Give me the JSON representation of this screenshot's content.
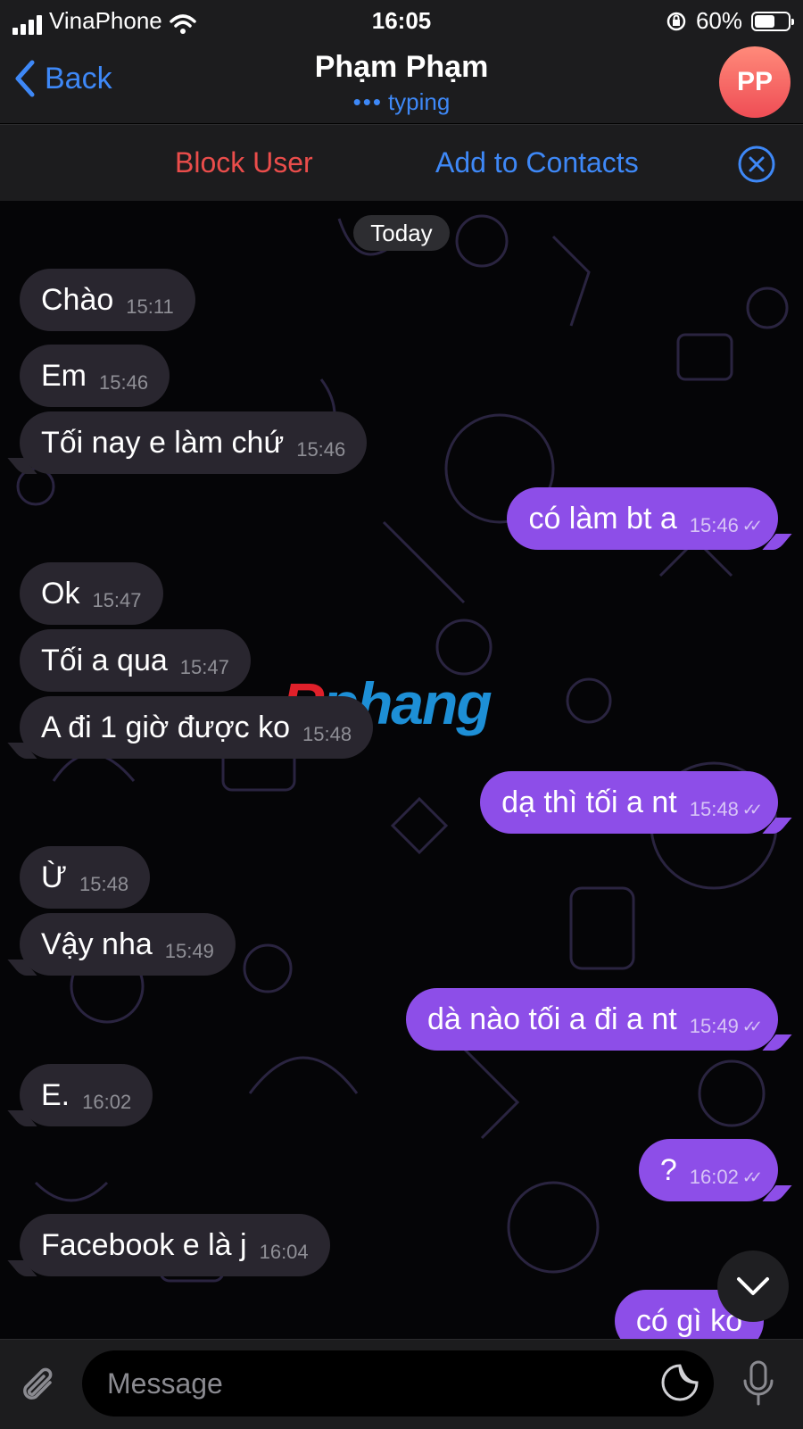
{
  "status_bar": {
    "carrier": "VinaPhone",
    "time": "16:05",
    "battery": "60%",
    "battery_level": 0.6
  },
  "header": {
    "back_label": "Back",
    "title": "Phạm Phạm",
    "status": "typing",
    "avatar_initials": "PP"
  },
  "actions": {
    "block_label": "Block User",
    "add_contacts_label": "Add to Contacts"
  },
  "chat": {
    "date_separator": "Today",
    "messages": [
      {
        "dir": "in",
        "text": "Chào",
        "time": "15:11"
      },
      {
        "dir": "in",
        "text": "Em",
        "time": "15:46"
      },
      {
        "dir": "in",
        "text": "Tối nay e làm chứ",
        "time": "15:46"
      },
      {
        "dir": "out",
        "text": "có làm bt a",
        "time": "15:46",
        "read": true
      },
      {
        "dir": "in",
        "text": "Ok",
        "time": "15:47"
      },
      {
        "dir": "in",
        "text": "Tối a qua",
        "time": "15:47"
      },
      {
        "dir": "in",
        "text": "A đi 1 giờ được ko",
        "time": "15:48"
      },
      {
        "dir": "out",
        "text": "dạ thì tối a nt",
        "time": "15:48",
        "read": true
      },
      {
        "dir": "in",
        "text": "Ừ",
        "time": "15:48"
      },
      {
        "dir": "in",
        "text": "Vậy nha",
        "time": "15:49"
      },
      {
        "dir": "out",
        "text": "dà nào tối a đi a nt",
        "time": "15:49",
        "read": true
      },
      {
        "dir": "in",
        "text": "E.",
        "time": "16:02"
      },
      {
        "dir": "out",
        "text": "?",
        "time": "16:02",
        "read": true
      },
      {
        "dir": "in",
        "text": "Facebook e là j",
        "time": "16:04"
      },
      {
        "dir": "out",
        "text": "có gì ko",
        "time": "",
        "read": false
      }
    ]
  },
  "watermark": {
    "part1": "R",
    "part2": "phang"
  },
  "composer": {
    "placeholder": "Message"
  },
  "colors": {
    "accent": "#3e88f7",
    "danger": "#eb4d4b",
    "outgoing_bubble": "#8d4ee8",
    "incoming_bubble": "#29262f",
    "avatar": "#ef5a5a"
  },
  "icons": {
    "back": "chevron-left-icon",
    "close": "close-circle-icon",
    "scroll": "chevron-down-icon",
    "attach": "paperclip-icon",
    "sticker": "sticker-icon",
    "mic": "microphone-icon",
    "wifi": "wifi-icon",
    "lock": "rotation-lock-icon",
    "signal": "signal-icon",
    "battery": "battery-icon"
  }
}
